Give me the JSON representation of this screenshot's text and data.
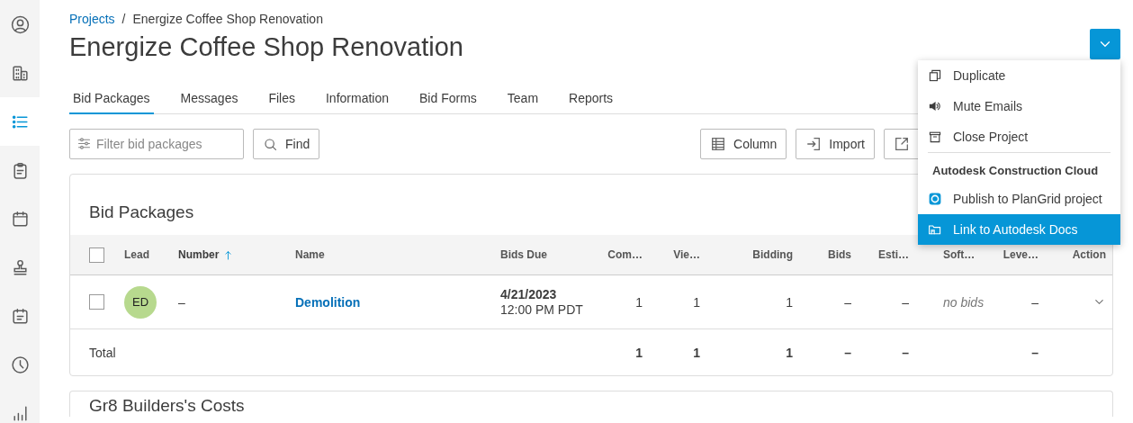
{
  "sidebar": {
    "items": [
      {
        "kind": "profile",
        "selected": false
      },
      {
        "kind": "building",
        "selected": false
      },
      {
        "kind": "list",
        "selected": true
      },
      {
        "kind": "clipboard",
        "selected": false
      },
      {
        "kind": "calendar",
        "selected": false
      },
      {
        "kind": "stamp",
        "selected": false
      },
      {
        "kind": "schedule",
        "selected": false
      },
      {
        "kind": "clock",
        "selected": false
      },
      {
        "kind": "chart",
        "selected": false
      }
    ]
  },
  "breadcrumb": {
    "link": "Projects",
    "separator": "/",
    "current": "Energize Coffee Shop Renovation"
  },
  "title": "Energize Coffee Shop Renovation",
  "menu": {
    "expanded": true,
    "sections": [
      {
        "items": [
          {
            "kind": "duplicate",
            "label": "Duplicate",
            "highlighted": false
          },
          {
            "kind": "mute",
            "label": "Mute Emails",
            "highlighted": false
          },
          {
            "kind": "archive",
            "label": "Close Project",
            "highlighted": false
          }
        ]
      },
      {
        "heading": "Autodesk Construction Cloud",
        "items": [
          {
            "kind": "plangrid",
            "label": "Publish to PlanGrid project",
            "highlighted": false
          },
          {
            "kind": "docs",
            "label": "Link to Autodesk Docs",
            "highlighted": true
          }
        ]
      }
    ]
  },
  "tabs": [
    {
      "label": "Bid Packages",
      "selected": true
    },
    {
      "label": "Messages",
      "selected": false
    },
    {
      "label": "Files",
      "selected": false
    },
    {
      "label": "Information",
      "selected": false
    },
    {
      "label": "Bid Forms",
      "selected": false
    },
    {
      "label": "Team",
      "selected": false
    },
    {
      "label": "Reports",
      "selected": false
    }
  ],
  "toolbar": {
    "filter": {
      "placeholder": "Filter bid packages"
    },
    "find": "Find",
    "buttons": [
      {
        "kind": "columns",
        "label": "Column"
      },
      {
        "kind": "import",
        "label": "Import"
      },
      {
        "kind": "export"
      }
    ]
  },
  "bid_packages": {
    "title": "Bid Packages",
    "select_all": {
      "checked": false
    },
    "columns": [
      {
        "label": "Lead",
        "sorted": false
      },
      {
        "label": "Number",
        "sorted": true
      },
      {
        "label": "Name",
        "sorted": false
      },
      {
        "label": "Bids Due",
        "sorted": false
      },
      {
        "label": "Com…",
        "sorted": false
      },
      {
        "label": "Vie…",
        "sorted": false
      },
      {
        "label": "Bidding",
        "sorted": false
      },
      {
        "label": "Bids",
        "sorted": false
      },
      {
        "label": "Esti…",
        "sorted": false
      },
      {
        "label": "Soft…",
        "sorted": false
      },
      {
        "label": "Leve…",
        "sorted": false
      },
      {
        "label": "Action",
        "sorted": false
      }
    ],
    "rows": [
      {
        "checked": false,
        "cells": [
          {
            "kind": "avatar",
            "text": "ED",
            "color": "#b7d98e"
          },
          {
            "kind": "text",
            "text": "–"
          },
          {
            "kind": "link",
            "text": "Demolition"
          },
          {
            "kind": "date",
            "date": "4/21/2023",
            "time": "12:00 PM PDT"
          },
          {
            "kind": "text",
            "text": "1"
          },
          {
            "kind": "text",
            "text": "1"
          },
          {
            "kind": "text",
            "text": "1"
          },
          {
            "kind": "text",
            "text": "–"
          },
          {
            "kind": "text",
            "text": "–"
          },
          {
            "kind": "muted",
            "text": "no bids"
          },
          {
            "kind": "text",
            "text": "–"
          },
          {
            "kind": "action"
          }
        ]
      }
    ],
    "total": {
      "label": "Total",
      "cells": [
        {
          "kind": "text",
          "text": "1"
        },
        {
          "kind": "text",
          "text": "1"
        },
        {
          "kind": "text",
          "text": "1"
        },
        {
          "kind": "text",
          "text": "–"
        },
        {
          "kind": "text",
          "text": "–"
        },
        {
          "kind": "empty"
        },
        {
          "kind": "text",
          "text": "–"
        },
        {
          "kind": "empty"
        }
      ]
    }
  },
  "costs": {
    "title": "Gr8 Builders's Costs"
  }
}
